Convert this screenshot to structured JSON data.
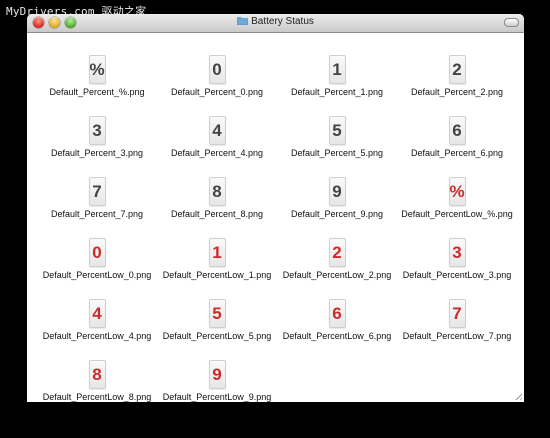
{
  "watermark": "MyDrivers.com 驱动之家",
  "window": {
    "title": "Battery Status"
  },
  "files": [
    {
      "glyph": "%",
      "name": "Default_Percent_%.png",
      "low": false
    },
    {
      "glyph": "0",
      "name": "Default_Percent_0.png",
      "low": false
    },
    {
      "glyph": "1",
      "name": "Default_Percent_1.png",
      "low": false
    },
    {
      "glyph": "2",
      "name": "Default_Percent_2.png",
      "low": false
    },
    {
      "glyph": "3",
      "name": "Default_Percent_3.png",
      "low": false
    },
    {
      "glyph": "4",
      "name": "Default_Percent_4.png",
      "low": false
    },
    {
      "glyph": "5",
      "name": "Default_Percent_5.png",
      "low": false
    },
    {
      "glyph": "6",
      "name": "Default_Percent_6.png",
      "low": false
    },
    {
      "glyph": "7",
      "name": "Default_Percent_7.png",
      "low": false
    },
    {
      "glyph": "8",
      "name": "Default_Percent_8.png",
      "low": false
    },
    {
      "glyph": "9",
      "name": "Default_Percent_9.png",
      "low": false
    },
    {
      "glyph": "%",
      "name": "Default_PercentLow_%.png",
      "low": true
    },
    {
      "glyph": "0",
      "name": "Default_PercentLow_0.png",
      "low": true
    },
    {
      "glyph": "1",
      "name": "Default_PercentLow_1.png",
      "low": true
    },
    {
      "glyph": "2",
      "name": "Default_PercentLow_2.png",
      "low": true
    },
    {
      "glyph": "3",
      "name": "Default_PercentLow_3.png",
      "low": true
    },
    {
      "glyph": "4",
      "name": "Default_PercentLow_4.png",
      "low": true
    },
    {
      "glyph": "5",
      "name": "Default_PercentLow_5.png",
      "low": true
    },
    {
      "glyph": "6",
      "name": "Default_PercentLow_6.png",
      "low": true
    },
    {
      "glyph": "7",
      "name": "Default_PercentLow_7.png",
      "low": true
    },
    {
      "glyph": "8",
      "name": "Default_PercentLow_8.png",
      "low": true
    },
    {
      "glyph": "9",
      "name": "Default_PercentLow_9.png",
      "low": true
    }
  ],
  "colors": {
    "normal_digit": "#444444",
    "low_digit": "#cc2b2b"
  }
}
